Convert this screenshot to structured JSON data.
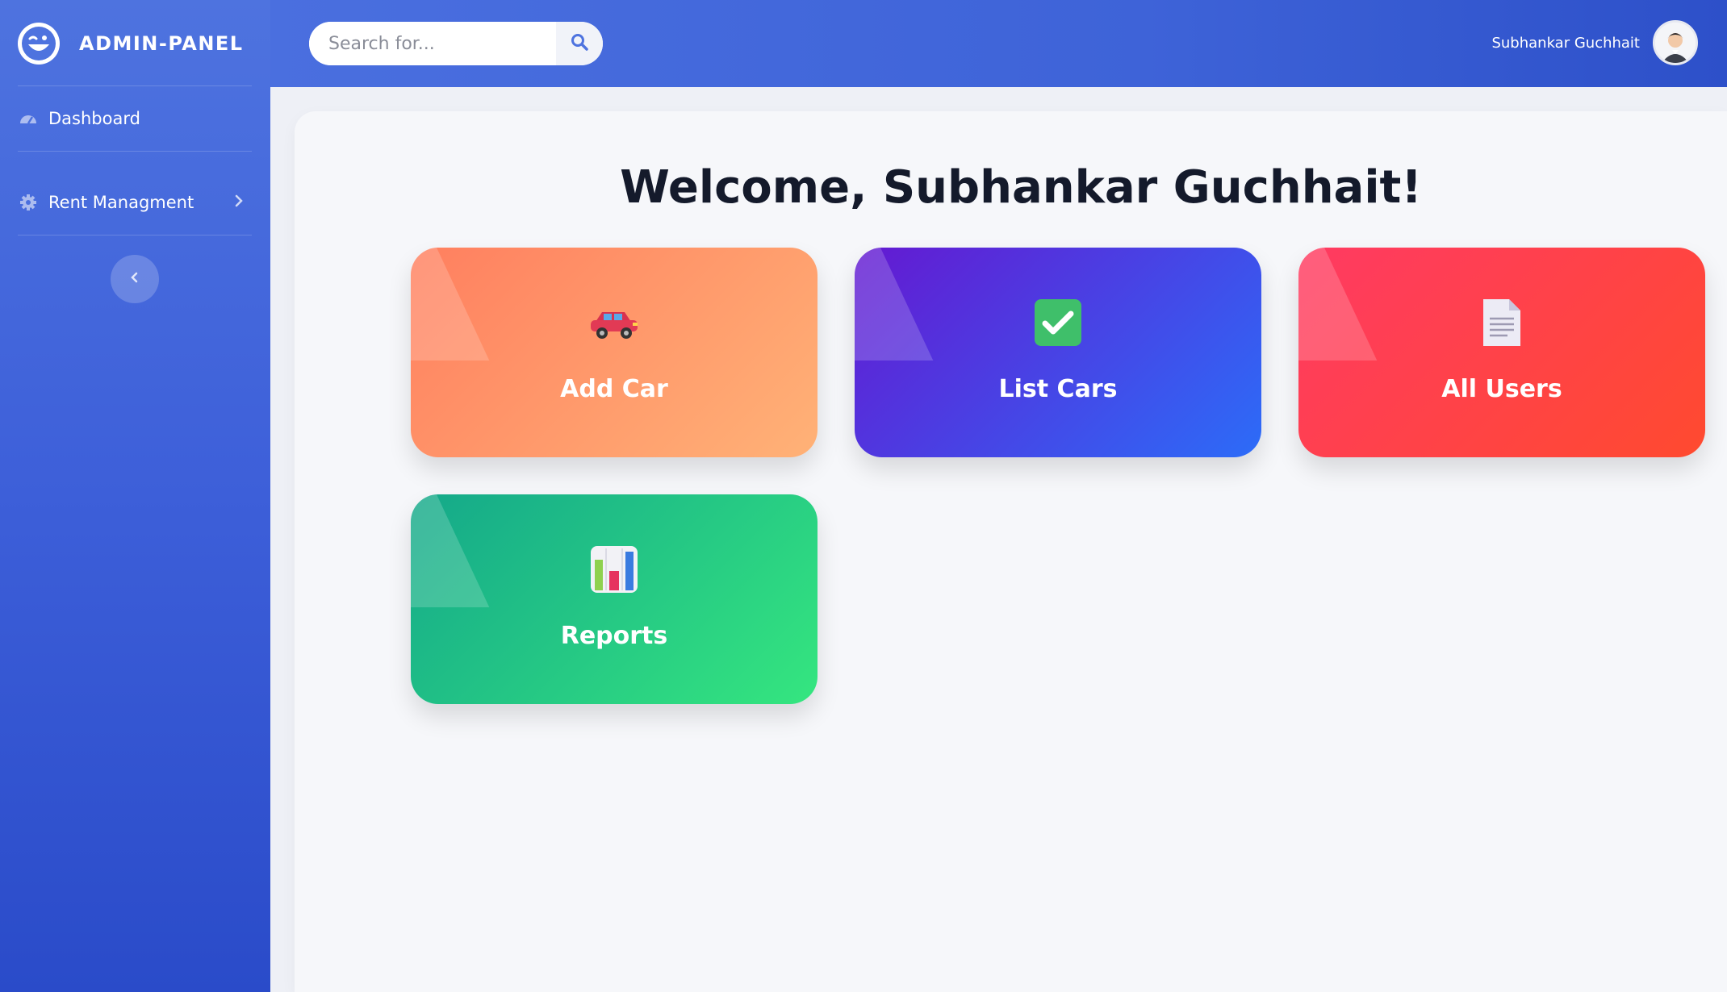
{
  "brand": {
    "title": "ADMIN-PANEL",
    "logo_icon": "winking-face-icon"
  },
  "sidebar": {
    "items": [
      {
        "label": "Dashboard",
        "icon": "dashboard-gauge-icon"
      },
      {
        "label": "Rent Managment",
        "icon": "gear-icon",
        "has_submenu": true
      }
    ],
    "collapse_icon": "chevron-left-icon"
  },
  "topbar": {
    "search": {
      "placeholder": "Search for...",
      "value": ""
    },
    "user_name": "Subhankar Guchhait"
  },
  "main": {
    "welcome": "Welcome, Subhankar Guchhait!",
    "cards": [
      {
        "label": "Add Car",
        "icon": "car-icon",
        "color_from": "#ff7f5f",
        "color_to": "#ffb277"
      },
      {
        "label": "List Cars",
        "icon": "check-mark-icon",
        "color_from": "#6419d1",
        "color_to": "#2c6cf8"
      },
      {
        "label": "All Users",
        "icon": "document-icon",
        "color_from": "#ff3a62",
        "color_to": "#ff4a2f"
      },
      {
        "label": "Reports",
        "icon": "bar-chart-icon",
        "color_from": "#14a88a",
        "color_to": "#35e67f"
      }
    ]
  },
  "colors": {
    "accent": "#4e73df",
    "heading": "#141a2b"
  }
}
